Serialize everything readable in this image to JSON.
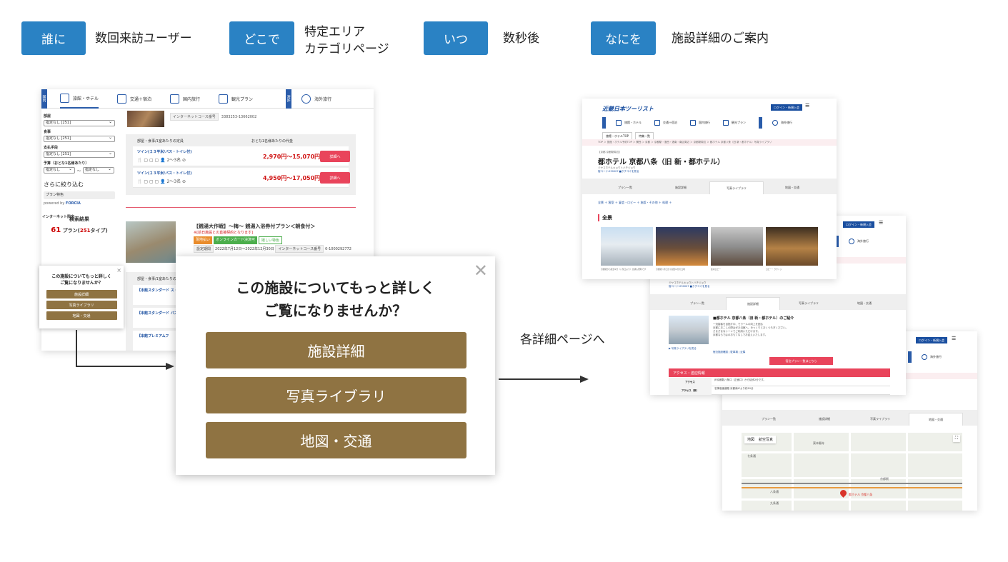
{
  "header": {
    "who_tag": "誰に",
    "who_text": "数回来訪ユーザー",
    "where_tag": "どこで",
    "where_text_1": "特定エリア",
    "where_text_2": "カテゴリページ",
    "when_tag": "いつ",
    "when_text": "数秒後",
    "what_tag": "なにを",
    "what_text": "施設詳細のご案内"
  },
  "left_page": {
    "nav": {
      "domestic": "国内",
      "hotel": "旅館・ホテル",
      "transport": "交通＋宿泊",
      "domestic_trip": "国内旅行",
      "tour": "観光プラン",
      "overseas_tag": "海外",
      "overseas": "海外旅行"
    },
    "sidebar": {
      "room_label": "部屋",
      "room_value": "指定なし [251]",
      "meal_label": "食事",
      "meal_value": "指定なし [251]",
      "pay_label": "支払手段",
      "pay_value": "指定なし [251]",
      "budget_label": "予算（おとな1名様あたり）",
      "budget_from": "指定なし",
      "budget_sep": "〜",
      "budget_to": "指定なし",
      "narrow": "さらに絞り込む",
      "plan_feature": "プラン特色",
      "powered": "powered by",
      "forcia": "FORCIA",
      "result_title": "検索結果",
      "result_count": "61",
      "result_plan": "プラン(",
      "result_types": "251",
      "result_suffix": "タイプ)"
    },
    "plan1": {
      "code_label": "インターネットコース番号",
      "code_value": "3383253-13662002",
      "head_room": "部屋・食事/1室あたりの定員",
      "head_price": "おとな1名様あたりの代金",
      "rooms": [
        {
          "name": "ツイン(２３平米/バス・トイレ付)",
          "amenity": "🍴 ▢ ▢ ▢ 👤 2〜3名 ⊘",
          "price": "2,970円〜15,070円",
          "button": "詳細へ"
        },
        {
          "name": "ツイン(２３平米/バス・トイレ付)",
          "amenity": "🍴 ▢ ▢ ▢ 👤 2〜3名 ⊘",
          "price": "4,950円〜17,050円",
          "button": "詳細へ"
        }
      ]
    },
    "plan2": {
      "internet_label": "インターネット限定",
      "title": "【銭湯大作戦】〜梅〜 銭湯入浴券付プラン＜朝食付＞",
      "note": "※[前日施設との直接契約となります]",
      "badges": [
        "現地払い",
        "オンラインカード決済可",
        "嬉しい特色"
      ],
      "period_label": "設定期間",
      "period_value": "2022年7月12日〜2022年12月30日",
      "code_label": "インターネットコース番号",
      "code_value": "0-1000292772",
      "head_room": "部屋・食事/1室あたりの定員",
      "rooms": [
        "【本館スタンダード ス・トイレ付トリプ",
        "【本館スタンダード バス・トイレ付ツイ",
        "【本館プレミアムフ"
      ]
    },
    "mini_popup": {
      "title_1": "この施設についてもっと詳しく",
      "title_2": "ご覧になりませんか？",
      "close": "×",
      "buttons": [
        "施設詳細",
        "写真ライブラリ",
        "地図・交通"
      ]
    }
  },
  "popup": {
    "title_1": "この施設についてもっと詳しく",
    "title_2": "ご覧になりませんか？",
    "close": "✕",
    "buttons": [
      "施設詳細",
      "写真ライブラリ",
      "地図・交通"
    ]
  },
  "arrow_label": "各詳細ページへ",
  "right_pages": {
    "logo": "近畿日本ツーリスト",
    "login": "ログイン・新規入会",
    "menu_icon": "☰",
    "nav": [
      "旅館・ホテル",
      "交通＋宿泊",
      "国内旅行",
      "観光プラン",
      "海外旅行"
    ],
    "subtabs": [
      "旅館・ホテルTOP",
      "特集一覧"
    ],
    "breadcrumb": "TOP ＞ 旅館・ホテル予約TOP ＞ 関西 ＞ 京都 ＞ 京都駅・洛西・洛南・南区周辺 ＞ 京都駅周辺 ＞ 都ホテル 京都八条（旧 新・都ホテル）写真ライブラリ",
    "hotel_small": "【京都 京都駅周辺】",
    "hotel_name": "都ホテル 京都八条（旧 新・都ホテル）",
    "hotel_kana": "ミヤコホテルキョウトハチジョウ",
    "hotel_code": "宿コード:030007 ■クチコミを見る",
    "tabs": [
      "プラン一覧",
      "施設詳細",
      "写真ライブラリ",
      "地図・交通"
    ],
    "photo_crumbs": "全景 ＋ 客室 ＋ 宴会・ロビー ＋ 施設・その他 ＋ 料理 ＋",
    "section": "全景",
    "photo_caps": [
      "京都駅から徒歩2分（八条口より）交通も便利です",
      "京都駅八条口から徒歩2分の立地",
      "館内ロビー",
      "ロビー・ラウンジ"
    ],
    "facility_title": "■都ホテル 京都八条（旧 新・都ホテル）のご紹介",
    "facility_lines": [
      "一流接客を目指す中、モラールの向上を図る",
      "京都におこしの際はぜひ当館へ。ゆっくりとおくつろぎください。",
      "さまざまなシーンでご利用いただけます。",
      "京都ならではのおもてなしでお迎えいたします。"
    ],
    "facility_link": "▶ 写真ライブラリを見る",
    "facility_mini": "宿泊施設確認 | 駐車場 | 近隣",
    "facility_button": "宿泊プラン一覧はこちら",
    "access_bar": "アクセス・送迎情報",
    "access_rows": [
      {
        "k": "アクセス",
        "v": "JR京都駅八条口（正面口）から徒歩2分です。"
      },
      {
        "k": "アクセス（車）",
        "v": "名神高速道路 京都南ICより約10分"
      }
    ],
    "map_tabs": [
      "地図",
      "航空写真"
    ],
    "map_labels": [
      "京都駅",
      "東本願寺",
      "七条通",
      "八条通",
      "九条通",
      "都ホテル 京都八条"
    ],
    "map_fullscreen": "⛶"
  }
}
